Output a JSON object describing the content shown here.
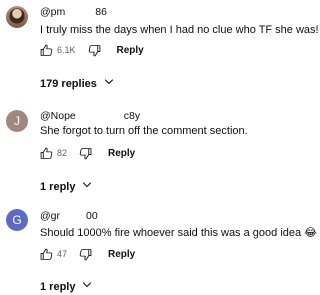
{
  "comments": [
    {
      "handle_start": "@pm",
      "handle_end": "86",
      "text": "I truly miss the days when I had no clue who TF she was!",
      "like_count": "6.1K",
      "reply_label": "Reply",
      "replies_label": "179 replies",
      "avatar_letter": ""
    },
    {
      "handle_start": "@Nope",
      "handle_end": "c8y",
      "text": "She forgot to turn off the comment section.",
      "like_count": "82",
      "reply_label": "Reply",
      "replies_label": "1 reply",
      "avatar_letter": "J",
      "avatar_color": "#a1887f"
    },
    {
      "handle_start": "@gr",
      "handle_end": "00",
      "text": "Should 1000% fire whoever said this was a good idea",
      "emoji": "😂",
      "like_count": "47",
      "reply_label": "Reply",
      "replies_label": "1 reply",
      "avatar_letter": "G",
      "avatar_color": "#5c6bc0"
    }
  ],
  "icons": {
    "like": "thumbs-up-icon",
    "dislike": "thumbs-down-icon",
    "expand": "chevron-down-icon"
  }
}
